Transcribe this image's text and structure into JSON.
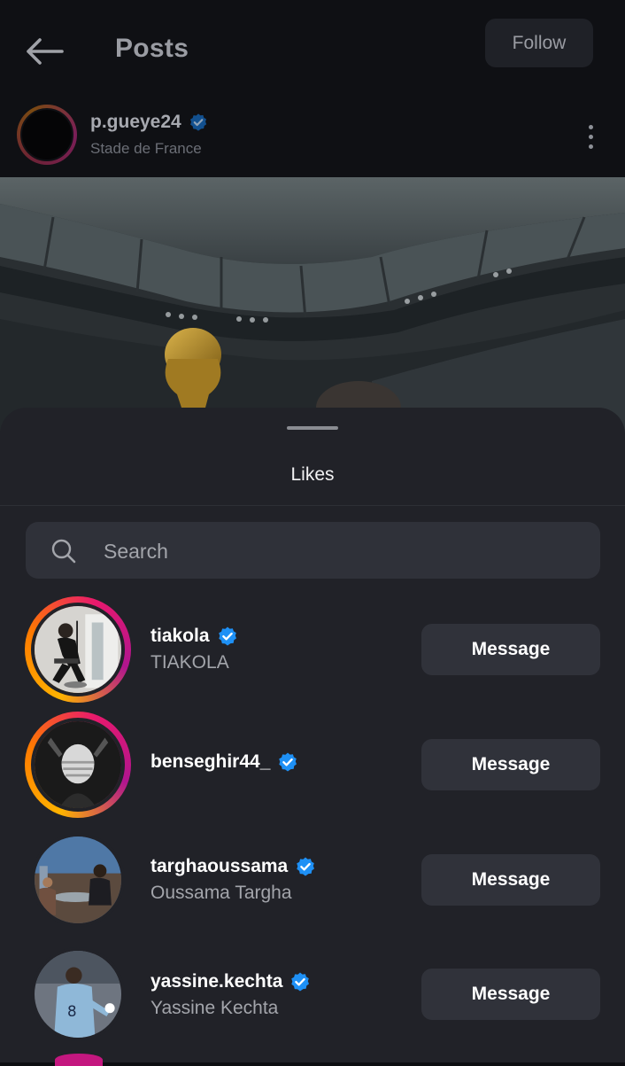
{
  "header": {
    "title": "Posts",
    "follow_label": "Follow"
  },
  "post": {
    "author": "p.gueye24",
    "location": "Stade de France",
    "author_verified": true
  },
  "likes_sheet": {
    "title": "Likes",
    "search_placeholder": "Search",
    "users": [
      {
        "username": "tiakola",
        "full_name": "TIAKOLA",
        "verified": true,
        "has_story": true,
        "action": "Message"
      },
      {
        "username": "benseghir44_",
        "full_name": "",
        "verified": true,
        "has_story": true,
        "action": "Message"
      },
      {
        "username": "targhaoussama",
        "full_name": "Oussama Targha",
        "verified": true,
        "has_story": false,
        "action": "Message"
      },
      {
        "username": "yassine.kechta",
        "full_name": "Yassine Kechta",
        "verified": true,
        "has_story": false,
        "action": "Message"
      }
    ]
  },
  "colors": {
    "background": "#0f1014",
    "sheet": "#212228",
    "button": "#30323a",
    "verified": "#1e90f5",
    "story_ring_start": "#ffb300",
    "story_ring_end": "#e8196d"
  },
  "icons": [
    "back-arrow-icon",
    "verified-badge-icon",
    "more-options-icon",
    "search-icon"
  ]
}
